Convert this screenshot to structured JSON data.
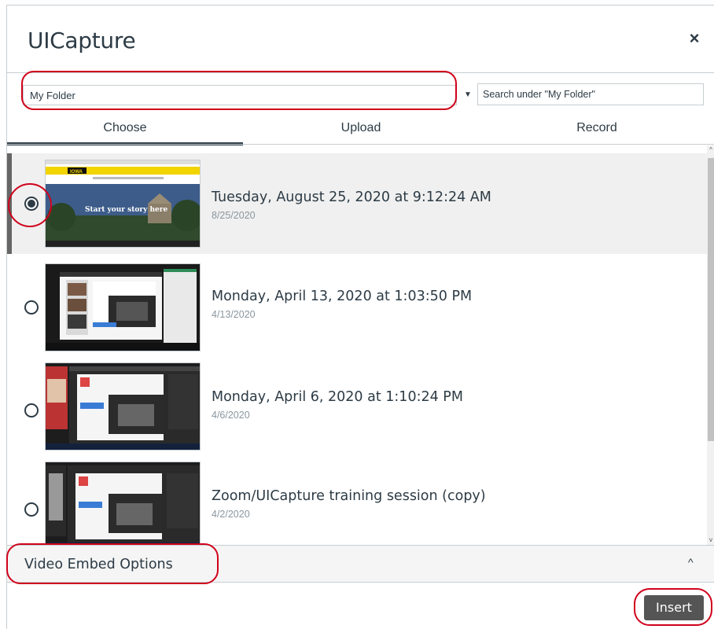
{
  "dialog": {
    "title": "UICapture",
    "close_label": "×"
  },
  "folder": {
    "selected": "My Folder",
    "arrow": "▼"
  },
  "search": {
    "placeholder": "Search under \"My Folder\""
  },
  "tabs": [
    {
      "label": "Choose",
      "active": true
    },
    {
      "label": "Upload",
      "active": false
    },
    {
      "label": "Record",
      "active": false
    }
  ],
  "items": [
    {
      "title": "Tuesday, August 25, 2020 at 9:12:24 AM",
      "date": "8/25/2020",
      "selected": true,
      "thumb_text": "Start your story here",
      "thumb_logo": "IOWA"
    },
    {
      "title": "Monday, April 13, 2020 at 1:03:50 PM",
      "date": "4/13/2020",
      "selected": false
    },
    {
      "title": "Monday, April 6, 2020 at 1:10:24 PM",
      "date": "4/6/2020",
      "selected": false
    },
    {
      "title": "Zoom/UICapture training session (copy)",
      "date": "4/2/2020",
      "selected": false
    }
  ],
  "scroll": {
    "up": "^",
    "down": "v"
  },
  "embed": {
    "label": "Video Embed Options",
    "chevron": "^"
  },
  "footer": {
    "insert_label": "Insert"
  },
  "colors": {
    "annotation": "#d0021b",
    "selected_row": "#f0f0f0",
    "text": "#2d3b45",
    "button": "#555555"
  }
}
